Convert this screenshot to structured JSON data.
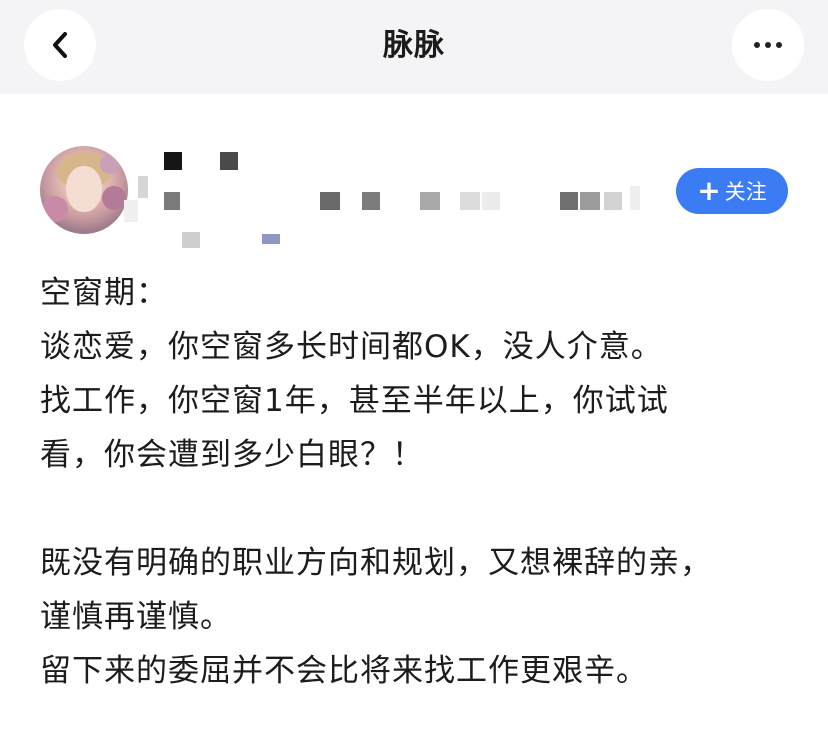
{
  "nav": {
    "title": "脉脉",
    "back_icon": "chevron-left-icon",
    "more_icon": "more-dots-icon"
  },
  "author": {
    "follow_label": "关注",
    "follow_icon": "plus-icon",
    "follow_color": "#3b7cf5"
  },
  "post": {
    "lines": [
      "空窗期：",
      "谈恋爱，你空窗多长时间都OK，没人介意。",
      "找工作，你空窗1年，甚至半年以上，你试试",
      "看，你会遭到多少白眼？！",
      "",
      "既没有明确的职业方向和规划，又想裸辞的亲，",
      "谨慎再谨慎。",
      "留下来的委屈并不会比将来找工作更艰辛。"
    ]
  }
}
